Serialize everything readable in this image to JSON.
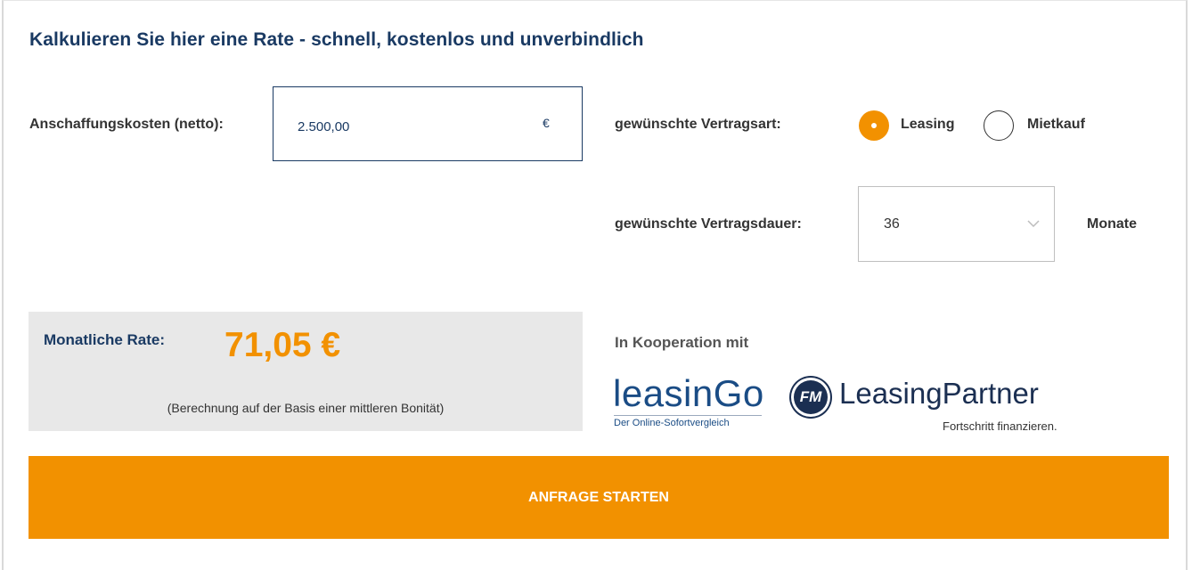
{
  "form": {
    "title": "Kalkulieren Sie hier eine Rate - schnell, kostenlos und unverbindlich",
    "cost": {
      "label": "Anschaffungskosten (netto):",
      "value": "2.500,00",
      "unit": "€"
    },
    "contract_type": {
      "label": "gewünschte Vertragsart:",
      "options": [
        {
          "label": "Leasing",
          "selected": true
        },
        {
          "label": "Mietkauf",
          "selected": false
        }
      ]
    },
    "duration": {
      "label": "gewünschte Vertragsdauer:",
      "value": "36",
      "unit": "Monate"
    }
  },
  "result": {
    "label": "Monatliche Rate:",
    "value": "71,05 €",
    "note": "(Berechnung auf der Basis einer mittleren Bonität)"
  },
  "cooperation": {
    "label": "In Kooperation mit",
    "partners": [
      {
        "name": "leasinGo",
        "tagline": "Der Online-Sofortvergleich",
        "icon": "leasingo-logo"
      },
      {
        "name": "LeasingPartner",
        "tagline": "Fortschritt finanzieren.",
        "badge": "FM",
        "icon": "leasingpartner-logo"
      }
    ]
  },
  "cta": {
    "label": "ANFRAGE STARTEN"
  },
  "colors": {
    "accent": "#f29100",
    "title": "#1a3a63",
    "panel": "#e8e8e8"
  }
}
